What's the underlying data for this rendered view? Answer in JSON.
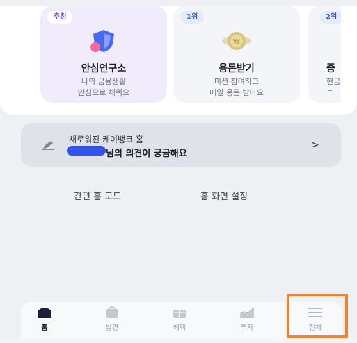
{
  "cards": [
    {
      "tag": "추천",
      "title": "안심연구소",
      "desc1": "나의 금융생활",
      "desc2": "안심으로 채워요"
    },
    {
      "tag": "1위",
      "title": "용돈받기",
      "desc1": "미션 참여하고",
      "desc2": "매일 용돈 받아요"
    },
    {
      "tag": "2위",
      "title": "증",
      "desc1": "현금",
      "desc2": "ㄷ"
    }
  ],
  "feedback": {
    "line1": "새로워진 케이뱅크 홈",
    "line2": "님의 의견이 궁금해요",
    "chevron": ">"
  },
  "modes": {
    "simple": "간편 홈 모드",
    "settings": "홈 화면 설정"
  },
  "tabs": [
    {
      "label": "홈",
      "icon": "home-icon",
      "active": true
    },
    {
      "label": "발견",
      "icon": "bag-icon",
      "active": false
    },
    {
      "label": "혜택",
      "icon": "gift-icon",
      "active": false
    },
    {
      "label": "투자",
      "icon": "chart-icon",
      "active": false
    },
    {
      "label": "전체",
      "icon": "menu-icon",
      "active": false
    }
  ],
  "colors": {
    "highlight": "#f0832d",
    "accent_purple": "#7b4ae0",
    "accent_blue": "#4465c8"
  }
}
